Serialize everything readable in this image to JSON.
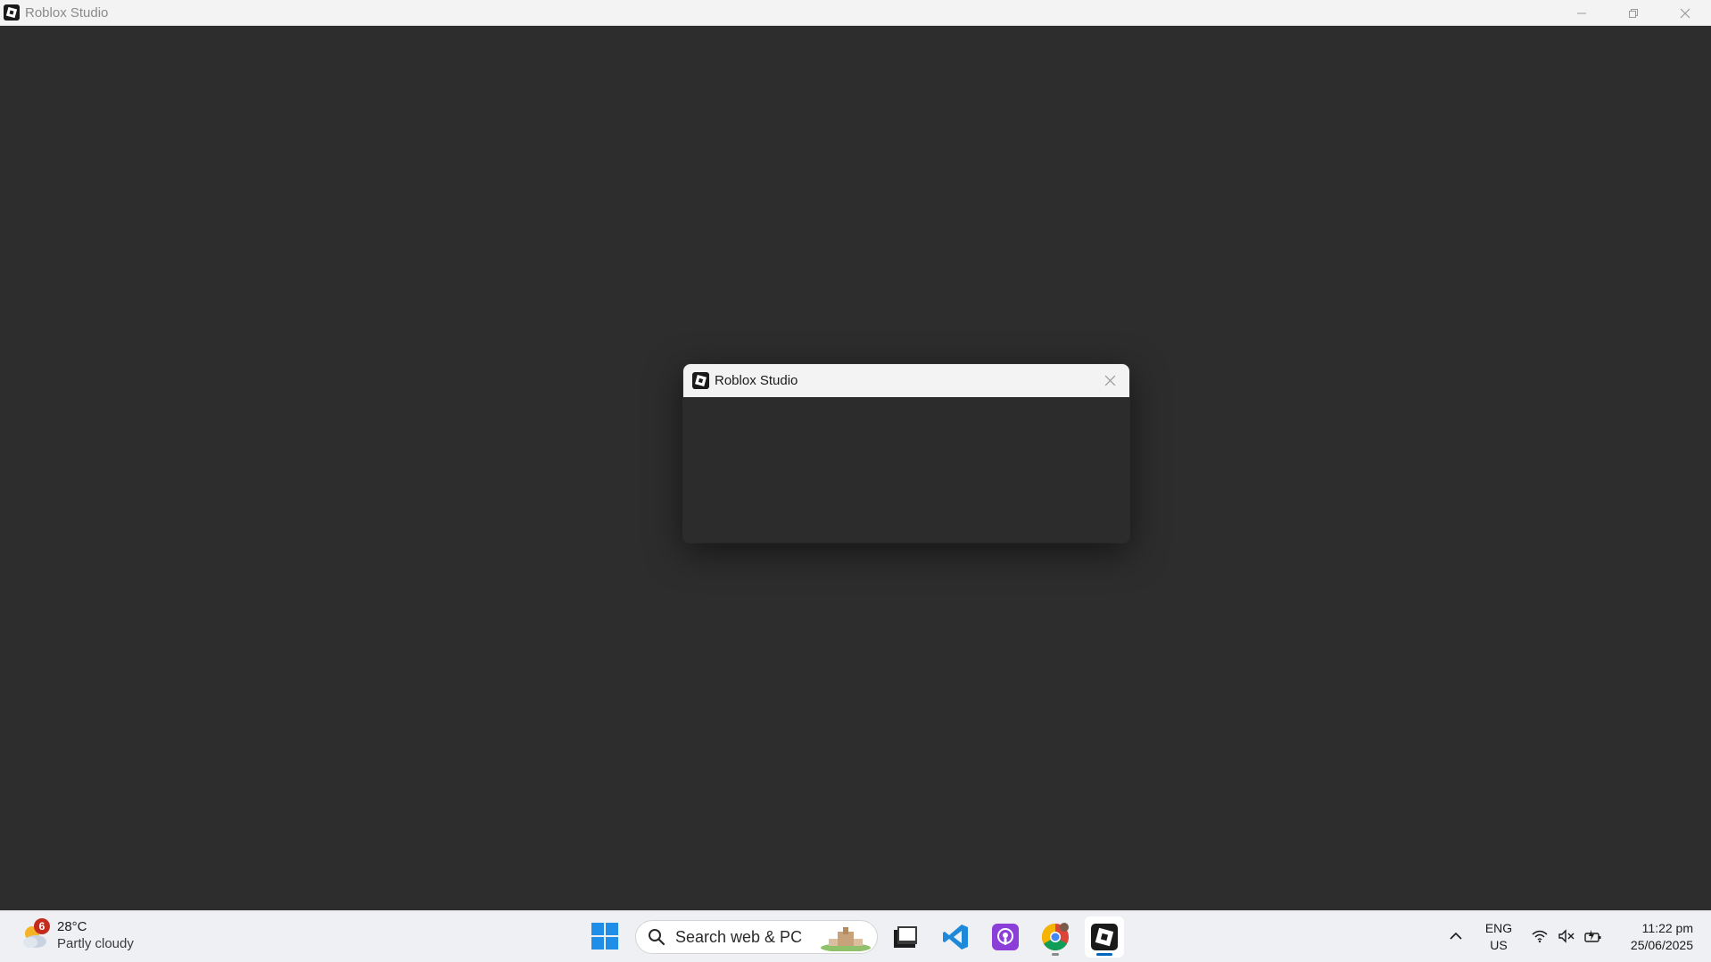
{
  "window": {
    "title": "Roblox Studio"
  },
  "dialog": {
    "title": "Roblox Studio"
  },
  "taskbar": {
    "weather": {
      "badge": "6",
      "temperature": "28°C",
      "condition": "Partly cloudy"
    },
    "search": {
      "placeholder": "Search web & PC"
    },
    "apps": [
      {
        "name": "file-explorer",
        "icon": "folder-icon"
      },
      {
        "name": "vs-code",
        "icon": "vscode-icon"
      },
      {
        "name": "podcast-app",
        "icon": "podcast-icon"
      },
      {
        "name": "chrome",
        "icon": "chrome-icon"
      },
      {
        "name": "roblox-studio",
        "icon": "roblox-studio-icon"
      }
    ],
    "language": {
      "line1": "ENG",
      "line2": "US"
    },
    "clock": {
      "time": "11:22 pm",
      "date": "25/06/2025"
    }
  },
  "colors": {
    "workspace": "#2d2d2d",
    "titlebar": "#f3f3f3",
    "taskbar": "#eef0f3",
    "accent": "#0067c0"
  }
}
